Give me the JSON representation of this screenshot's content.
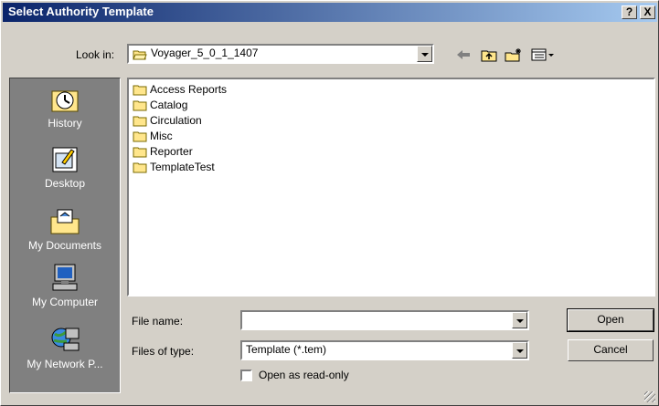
{
  "window": {
    "title": "Select Authority Template",
    "help": "?",
    "close": "X"
  },
  "lookin": {
    "label": "Look in:",
    "value": "Voyager_5_0_1_1407"
  },
  "places": [
    {
      "label": "History",
      "icon": "history-icon"
    },
    {
      "label": "Desktop",
      "icon": "desktop-icon"
    },
    {
      "label": "My Documents",
      "icon": "my-documents-icon"
    },
    {
      "label": "My Computer",
      "icon": "my-computer-icon"
    },
    {
      "label": "My Network P...",
      "icon": "my-network-icon"
    }
  ],
  "files": [
    "Access Reports",
    "Catalog",
    "Circulation",
    "Misc",
    "Reporter",
    "TemplateTest"
  ],
  "filename": {
    "label": "File name:",
    "value": ""
  },
  "filetype": {
    "label": "Files of type:",
    "value": "Template (*.tem)"
  },
  "readonly": {
    "label": "Open as read-only",
    "checked": false
  },
  "buttons": {
    "open": "Open",
    "cancel": "Cancel"
  },
  "colors": {
    "titlebar_start": "#0a246a",
    "titlebar_end": "#a6caf0",
    "folder": "#ffe68c"
  }
}
